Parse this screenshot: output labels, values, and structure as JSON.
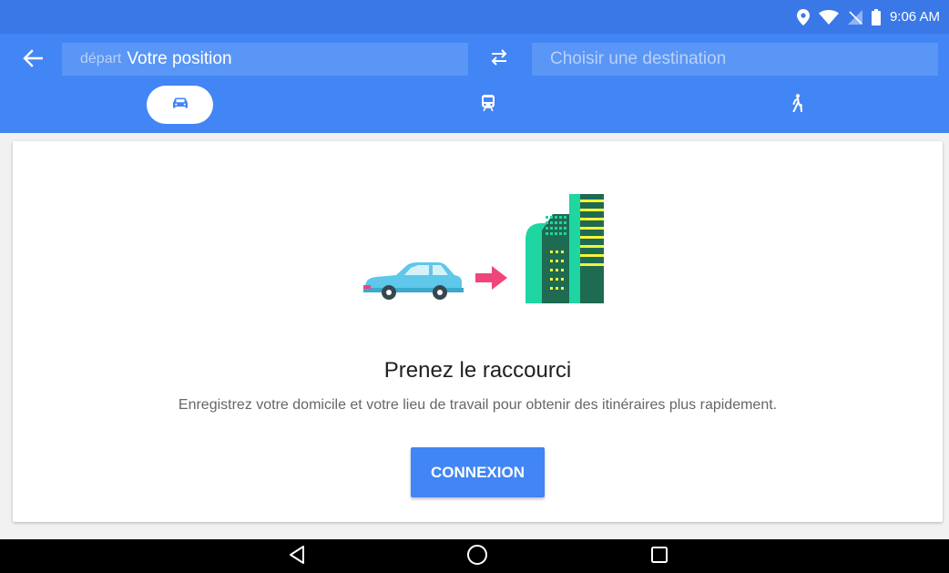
{
  "status_bar": {
    "time": "9:06 AM",
    "icons": [
      "location-icon",
      "wifi-icon",
      "no-signal-icon",
      "battery-icon"
    ]
  },
  "toolbar": {
    "back_icon": "arrow-left-icon",
    "origin": {
      "prefix": "départ",
      "value": "Votre position"
    },
    "swap_icon": "swap-arrows-icon",
    "destination": {
      "placeholder": "Choisir une destination",
      "value": ""
    },
    "modes": [
      {
        "id": "driving",
        "icon": "car-icon",
        "selected": true
      },
      {
        "id": "transit",
        "icon": "train-icon",
        "selected": false
      },
      {
        "id": "walking",
        "icon": "walking-icon",
        "selected": false
      }
    ]
  },
  "card": {
    "illustration_icons": [
      "car-icon",
      "arrow-right-icon",
      "buildings-icon"
    ],
    "title": "Prenez le raccourci",
    "description": "Enregistrez votre domicile et votre lieu de travail pour obtenir des itinéraires plus rapidement.",
    "button_label": "CONNEXION"
  },
  "colors": {
    "toolbar": "#4285f4",
    "status_bar": "#3b78e7",
    "accent": "#4285f4",
    "arrow": "#f0457a",
    "building_dark": "#1e6b52",
    "building_light": "#1fd5a2"
  },
  "nav_bar": {
    "icons": [
      "triangle-back-icon",
      "circle-home-icon",
      "square-recents-icon"
    ]
  }
}
